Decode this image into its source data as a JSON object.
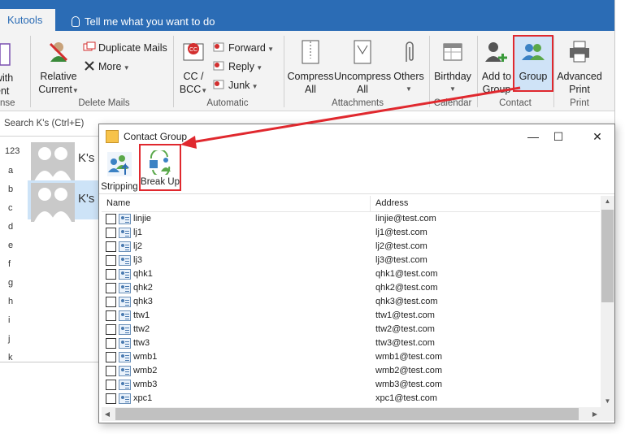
{
  "tabs": {
    "active": "Kutools",
    "tell_me": "Tell me what you want to do"
  },
  "ribbon": {
    "cut_left": {
      "label1": "with",
      "label2": "ent",
      "group": "nse"
    },
    "relative_current": {
      "line1": "Relative",
      "line2": "Current"
    },
    "duplicate_mails": "Duplicate Mails",
    "more": "More",
    "delete_mails_group": "Delete Mails",
    "cc_bcc": {
      "line1": "CC /",
      "line2": "BCC"
    },
    "forward": "Forward",
    "reply": "Reply",
    "junk": "Junk",
    "automatic_group": "Automatic",
    "compress_all": {
      "line1": "Compress",
      "line2": "All"
    },
    "uncompress_all": {
      "line1": "Uncompress",
      "line2": "All"
    },
    "others": "Others",
    "attachments_group": "Attachments",
    "birthday": "Birthday",
    "calendar_group": "Calendar",
    "add_to_group": {
      "line1": "Add to",
      "line2": "Group"
    },
    "group": "Group",
    "contact_group": "Contact",
    "advanced_print": {
      "line1": "Advanced",
      "line2": "Print"
    },
    "print_group": "Print"
  },
  "contacts_pane": {
    "search_placeholder": "Search K's (Ctrl+E)",
    "alphabet": [
      "123",
      "a",
      "b",
      "c",
      "d",
      "e",
      "f",
      "g",
      "h",
      "i",
      "j",
      "k"
    ],
    "cards": [
      {
        "name": "K's"
      },
      {
        "name": "K's"
      }
    ]
  },
  "dialog": {
    "title": "Contact Group",
    "tools": {
      "stripping": "Stripping",
      "break_up": "Break Up"
    },
    "columns": {
      "name": "Name",
      "address": "Address"
    },
    "rows": [
      {
        "name": "linjie",
        "address": "linjie@test.com"
      },
      {
        "name": "lj1",
        "address": "lj1@test.com"
      },
      {
        "name": "lj2",
        "address": "lj2@test.com"
      },
      {
        "name": "lj3",
        "address": "lj3@test.com"
      },
      {
        "name": "qhk1",
        "address": "qhk1@test.com"
      },
      {
        "name": "qhk2",
        "address": "qhk2@test.com"
      },
      {
        "name": "qhk3",
        "address": "qhk3@test.com"
      },
      {
        "name": "ttw1",
        "address": "ttw1@test.com"
      },
      {
        "name": "ttw2",
        "address": "ttw2@test.com"
      },
      {
        "name": "ttw3",
        "address": "ttw3@test.com"
      },
      {
        "name": "wmb1",
        "address": "wmb1@test.com"
      },
      {
        "name": "wmb2",
        "address": "wmb2@test.com"
      },
      {
        "name": "wmb3",
        "address": "wmb3@test.com"
      },
      {
        "name": "xpc1",
        "address": "xpc1@test.com"
      }
    ],
    "window_buttons": {
      "minimize": "—",
      "maximize": "☐",
      "close": "✕"
    }
  },
  "colors": {
    "tabbar": "#2b6cb5",
    "highlight_box": "#e0282e",
    "arrow": "#e0282e"
  }
}
